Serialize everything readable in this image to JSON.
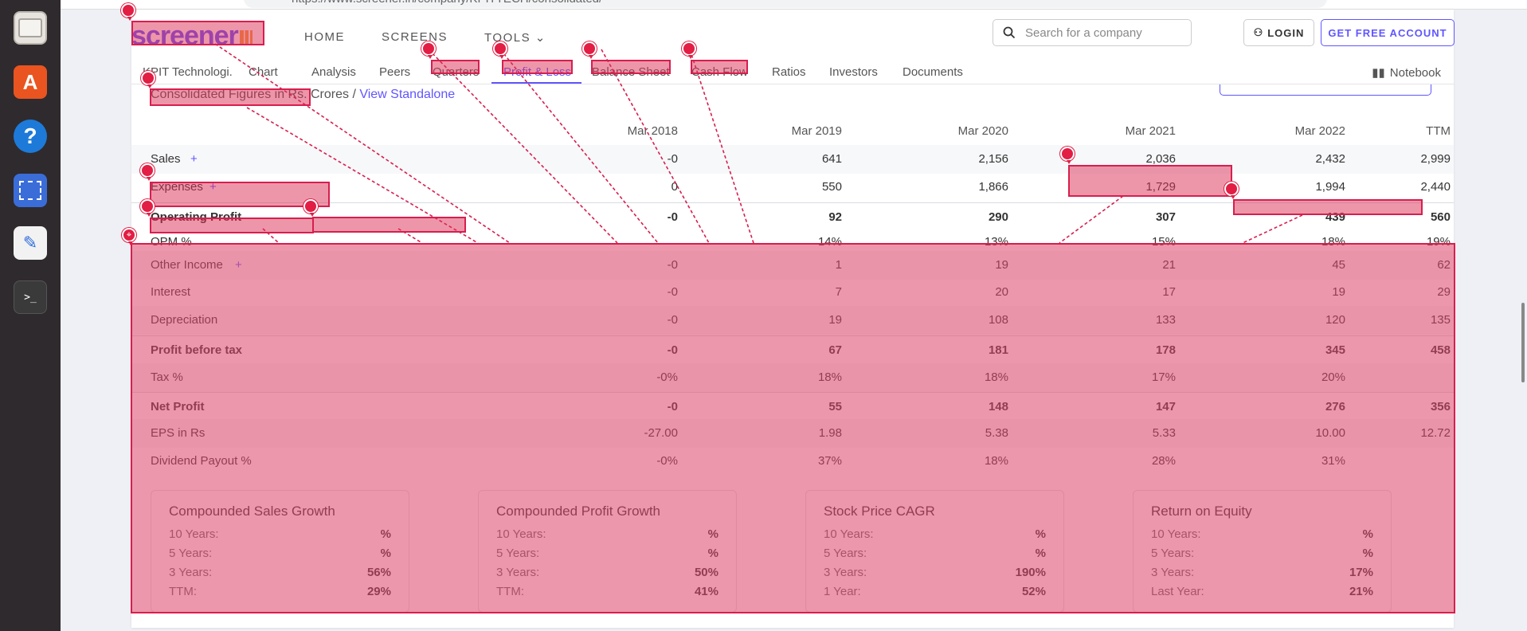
{
  "browser": {
    "url": "https://www.screener.in/company/KPITTECH/consolidated/"
  },
  "dock": {
    "items": [
      "files-icon",
      "app-store-icon",
      "help-icon",
      "screenshot-icon",
      "text-editor-icon",
      "terminal-icon"
    ],
    "help_glyph": "?",
    "store_glyph": "A",
    "terminal_glyph": ">_"
  },
  "nav": {
    "logo": "screener",
    "links": [
      "HOME",
      "SCREENS",
      "TOOLS"
    ],
    "search_placeholder": "Search for a company",
    "login": "LOGIN",
    "account": "GET FREE ACCOUNT"
  },
  "subnav": {
    "tabs": [
      "KPIT Technologi.",
      "Chart",
      "Analysis",
      "Peers",
      "Quarters",
      "Profit & Loss",
      "Balance Sheet",
      "Cash Flow",
      "Ratios",
      "Investors",
      "Documents"
    ],
    "active": "Profit & Loss",
    "notebook": "Notebook"
  },
  "heading": {
    "text": "Consolidated Figures in Rs. Crores / ",
    "link": "View Standalone"
  },
  "table": {
    "columns": [
      "Mar 2018",
      "Mar 2019",
      "Mar 2020",
      "Mar 2021",
      "Mar 2022",
      "TTM"
    ],
    "rows": [
      {
        "label": "Sales",
        "plus": "+",
        "values": [
          "-0",
          "641",
          "2,156",
          "2,036",
          "2,432",
          "2,999"
        ]
      },
      {
        "label": "Expenses",
        "plus": "+",
        "values": [
          "0",
          "550",
          "1,866",
          "1,729",
          "1,994",
          "2,440"
        ]
      },
      {
        "label": "Operating Profit",
        "bold": true,
        "values": [
          "-0",
          "92",
          "290",
          "307",
          "439",
          "560"
        ]
      },
      {
        "label": "OPM %",
        "values": [
          "",
          "14%",
          "13%",
          "15%",
          "18%",
          "19%"
        ]
      },
      {
        "label": "Other Income",
        "plus": "+",
        "values": [
          "-0",
          "1",
          "19",
          "21",
          "45",
          "62"
        ]
      },
      {
        "label": "Interest",
        "values": [
          "-0",
          "7",
          "20",
          "17",
          "19",
          "29"
        ]
      },
      {
        "label": "Depreciation",
        "values": [
          "-0",
          "19",
          "108",
          "133",
          "120",
          "135"
        ]
      },
      {
        "label": "Profit before tax",
        "bold": true,
        "values": [
          "-0",
          "67",
          "181",
          "178",
          "345",
          "458"
        ]
      },
      {
        "label": "Tax %",
        "values": [
          "-0%",
          "18%",
          "18%",
          "17%",
          "20%",
          ""
        ]
      },
      {
        "label": "Net Profit",
        "bold": true,
        "values": [
          "-0",
          "55",
          "148",
          "147",
          "276",
          "356"
        ]
      },
      {
        "label": "EPS in Rs",
        "values": [
          "-27.00",
          "1.98",
          "5.38",
          "5.33",
          "10.00",
          "12.72"
        ]
      },
      {
        "label": "Dividend Payout %",
        "values": [
          "-0%",
          "37%",
          "18%",
          "28%",
          "31%",
          ""
        ]
      }
    ]
  },
  "growth": [
    {
      "title": "Compounded Sales Growth",
      "lines": [
        [
          "10 Years:",
          "%"
        ],
        [
          "5 Years:",
          "%"
        ],
        [
          "3 Years:",
          "56%"
        ],
        [
          "TTM:",
          "29%"
        ]
      ]
    },
    {
      "title": "Compounded Profit Growth",
      "lines": [
        [
          "10 Years:",
          "%"
        ],
        [
          "5 Years:",
          "%"
        ],
        [
          "3 Years:",
          "50%"
        ],
        [
          "TTM:",
          "41%"
        ]
      ]
    },
    {
      "title": "Stock Price CAGR",
      "lines": [
        [
          "10 Years:",
          "%"
        ],
        [
          "5 Years:",
          "%"
        ],
        [
          "3 Years:",
          "190%"
        ],
        [
          "1 Year:",
          "52%"
        ]
      ]
    },
    {
      "title": "Return on Equity",
      "lines": [
        [
          "10 Years:",
          "%"
        ],
        [
          "5 Years:",
          "%"
        ],
        [
          "3 Years:",
          "17%"
        ],
        [
          "Last Year:",
          "21%"
        ]
      ]
    }
  ],
  "colors": {
    "accent": "#6056ff",
    "annotation": "#d81e4e"
  }
}
